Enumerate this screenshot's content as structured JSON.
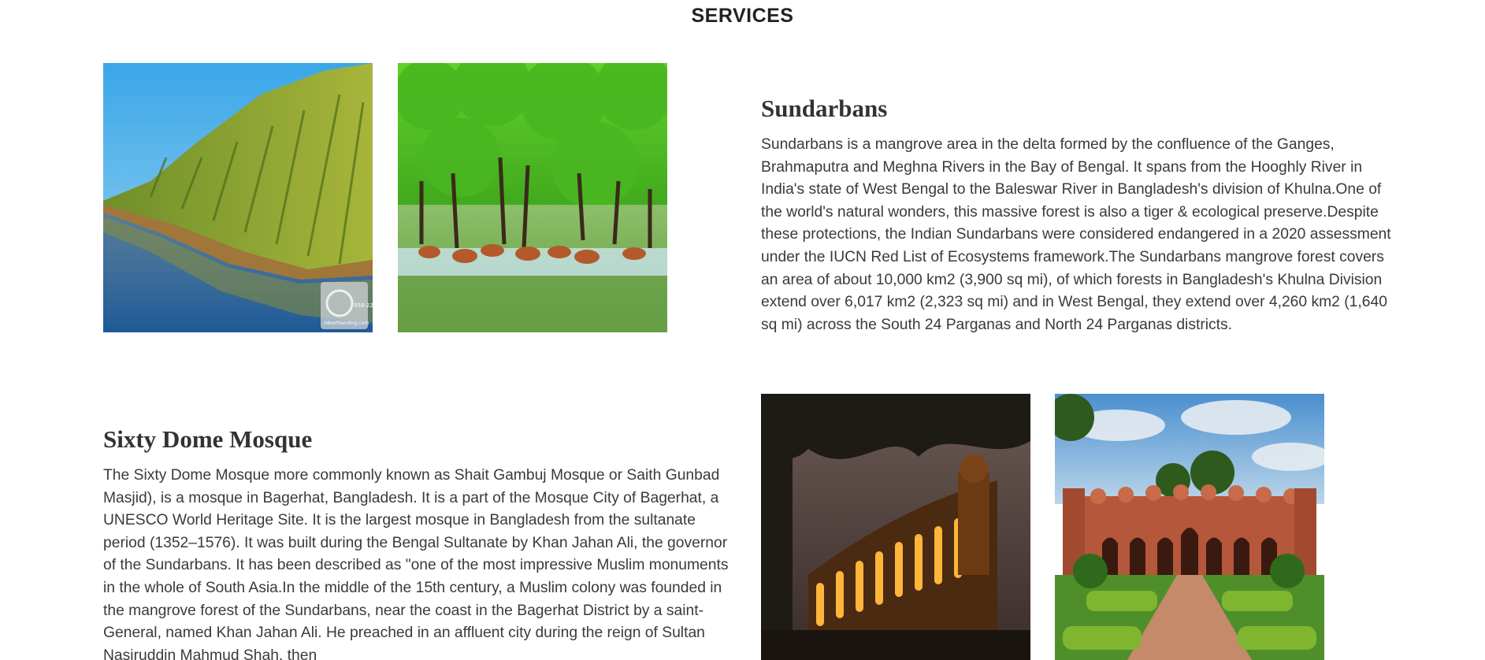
{
  "section": {
    "title": "SERVICES"
  },
  "sundarbans": {
    "heading": "Sundarbans",
    "description": "Sundarbans is a mangrove area in the delta formed by the confluence of the Ganges, Brahmaputra and Meghna Rivers in the Bay of Bengal. It spans from the Hooghly River in India's state of West Bengal to the Baleswar River in Bangladesh's division of Khulna.One of the world's natural wonders, this massive forest is also a tiger & ecological preserve.Despite these protections, the Indian Sundarbans were considered endangered in a 2020 assessment under the IUCN Red List of Ecosystems framework.The Sundarbans mangrove forest covers an area of about 10,000 km2 (3,900 sq mi), of which forests in Bangladesh's Khulna Division extend over 6,017 km2 (2,323 sq mi) and in West Bengal, they extend over 4,260 km2 (1,640 sq mi) across the South 24 Parganas and North 24 Parganas districts.",
    "photo1_watermark": "roberthanding.com",
    "photo1_watermark_code": "958-22"
  },
  "mosque": {
    "heading": "Sixty Dome Mosque",
    "description": "The Sixty Dome Mosque more commonly known as Shait Gambuj Mosque or Saith Gunbad Masjid), is a mosque in Bagerhat, Bangladesh. It is a part of the Mosque City of Bagerhat, a UNESCO World Heritage Site. It is the largest mosque in Bangladesh from the sultanate period (1352–1576). It was built during the Bengal Sultanate by Khan Jahan Ali, the governor of the Sundarbans. It has been described as \"one of the most impressive Muslim monuments in the whole of South Asia.In the middle of the 15th century, a Muslim colony was founded in the mangrove forest of the Sundarbans, near the coast in the Bagerhat District by a saint-General, named Khan Jahan Ali. He preached in an affluent city during the reign of Sultan Nasiruddin Mahmud Shah, then"
  },
  "colors": {
    "heading": "#333333",
    "body_text": "#3a3a3a",
    "background": "#ffffff"
  }
}
